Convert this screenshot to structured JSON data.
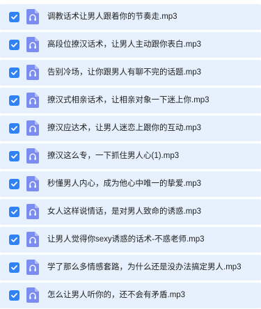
{
  "file_icon": "audio-file-icon",
  "accent_color": "#2f83f3",
  "file_icon_color": "#7b8df0",
  "row_background": "#e6f1fd",
  "files": [
    {
      "name": "调教话术让男人跟着你的节奏走.mp3",
      "checked": true
    },
    {
      "name": "高段位撩汉话术，让男人主动跟你表白.mp3",
      "checked": true
    },
    {
      "name": "告别冷场，让你跟男人有聊不完的话题.mp3",
      "checked": true
    },
    {
      "name": "撩汉式相亲话术，让相亲对象一下迷上你.mp3",
      "checked": true
    },
    {
      "name": "撩汉应达术，让男人迷恋上跟你的互动.mp3",
      "checked": true
    },
    {
      "name": "撩汉这么专，一下抓住男人心(1).mp3",
      "checked": true
    },
    {
      "name": "秒懂男人内心，成为他心中唯一的挚爱.mp3",
      "checked": true
    },
    {
      "name": "女人这样说情话，是对男人致命的诱惑.mp3",
      "checked": true
    },
    {
      "name": "让男人觉得你sexy诱惑的话术-不惑老师.mp3",
      "checked": true
    },
    {
      "name": "学了那么多情感套路，为什么还是没办法搞定男人.mp3",
      "checked": true
    },
    {
      "name": "怎么让男人听你的，还不会有矛盾.mp3",
      "checked": true
    }
  ]
}
